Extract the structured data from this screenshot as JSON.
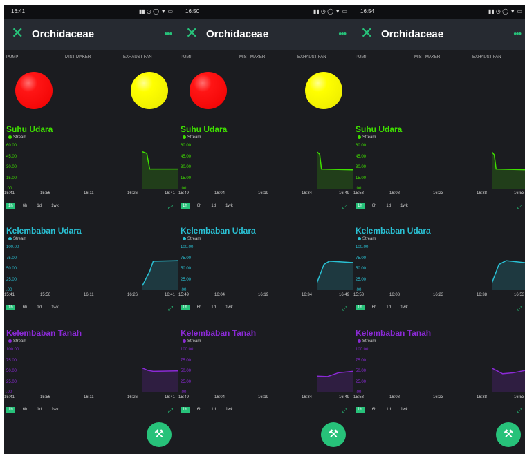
{
  "app": {
    "title": "Orchidaceae"
  },
  "widgets": {
    "pump": "PUMP",
    "mist": "MIST MAKER",
    "fan": "EXHAUST FAN"
  },
  "colors": {
    "green": "#27c27a",
    "suhu": "#3fe000",
    "kelembaban_udara": "#2ac1d4",
    "kelembaban_tanah": "#8b2ad6"
  },
  "ranges": [
    "1h",
    "6h",
    "1d",
    "1wk"
  ],
  "charts": {
    "suhu": {
      "title": "Suhu Udara",
      "legend": "Stream",
      "yticks": [
        "60.00",
        "45.00",
        "30.00",
        "15.00",
        ".00"
      ]
    },
    "udara": {
      "title": "Kelembaban Udara",
      "legend": "Stream",
      "yticks": [
        "100.00",
        "75.00",
        "50.00",
        "25.00",
        ".00"
      ]
    },
    "tanah": {
      "title": "Kelembaban Tanah",
      "legend": "Stream",
      "yticks": [
        "100.00",
        "75.00",
        "50.00",
        "25.00",
        ".00"
      ]
    }
  },
  "screens": [
    {
      "time": "16:41",
      "xticks": [
        "15:41",
        "15:56",
        "16:11",
        "16:26",
        "16:41"
      ],
      "pump": "on",
      "fan": "on",
      "suhu": [
        [
          0,
          47
        ],
        [
          0.12,
          45
        ],
        [
          0.2,
          25
        ],
        [
          1,
          25
        ]
      ],
      "udara": [
        [
          0,
          10
        ],
        [
          0.2,
          40
        ],
        [
          0.3,
          62
        ],
        [
          1,
          63
        ]
      ],
      "tanah": [
        [
          0,
          52
        ],
        [
          0.15,
          47
        ],
        [
          0.3,
          45
        ],
        [
          1,
          46
        ]
      ]
    },
    {
      "time": "16:50",
      "xticks": [
        "15:49",
        "16:04",
        "16:19",
        "16:34",
        "16:49"
      ],
      "pump": "on",
      "fan": "on",
      "suhu": [
        [
          0,
          47
        ],
        [
          0.08,
          44
        ],
        [
          0.13,
          25
        ],
        [
          1,
          24
        ]
      ],
      "udara": [
        [
          0,
          15
        ],
        [
          0.2,
          55
        ],
        [
          0.35,
          62
        ],
        [
          1,
          59
        ]
      ],
      "tanah": [
        [
          0,
          35
        ],
        [
          0.3,
          34
        ],
        [
          0.6,
          42
        ],
        [
          1,
          45
        ]
      ]
    },
    {
      "time": "16:54",
      "xticks": [
        "15:53",
        "16:08",
        "16:23",
        "16:38",
        "16:53"
      ],
      "pump": "off",
      "fan": "off",
      "suhu": [
        [
          0,
          47
        ],
        [
          0.07,
          43
        ],
        [
          0.12,
          25
        ],
        [
          1,
          24
        ]
      ],
      "udara": [
        [
          0,
          15
        ],
        [
          0.2,
          55
        ],
        [
          0.4,
          63
        ],
        [
          1,
          58
        ]
      ],
      "tanah": [
        [
          0,
          52
        ],
        [
          0.3,
          40
        ],
        [
          0.6,
          42
        ],
        [
          1,
          48
        ]
      ]
    }
  ]
}
